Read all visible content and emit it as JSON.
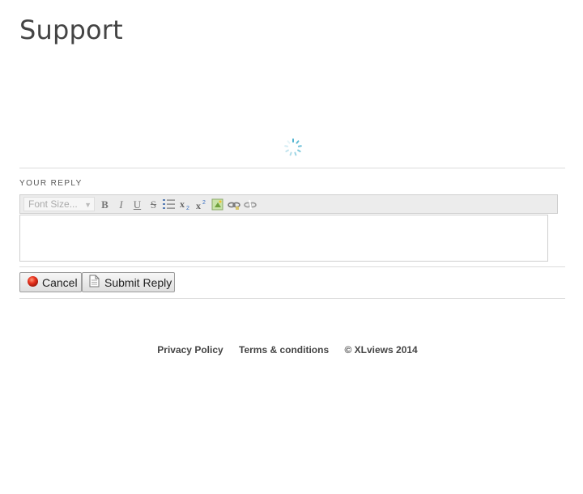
{
  "page": {
    "title": "Support"
  },
  "reply": {
    "section_label": "YOUR REPLY",
    "font_size_placeholder": "Font Size...",
    "toolbar": {
      "bold": "B",
      "italic": "I",
      "underline": "U",
      "strikethrough": "S"
    },
    "cancel_label": "Cancel",
    "submit_label": "Submit Reply"
  },
  "footer": {
    "privacy": "Privacy Policy",
    "terms": "Terms & conditions",
    "copyright": "© XLviews 2014"
  },
  "colors": {
    "spinner": "#4fb3cf",
    "cancel_icon": "#e8321e",
    "toolbar_bg": "#ececec"
  }
}
